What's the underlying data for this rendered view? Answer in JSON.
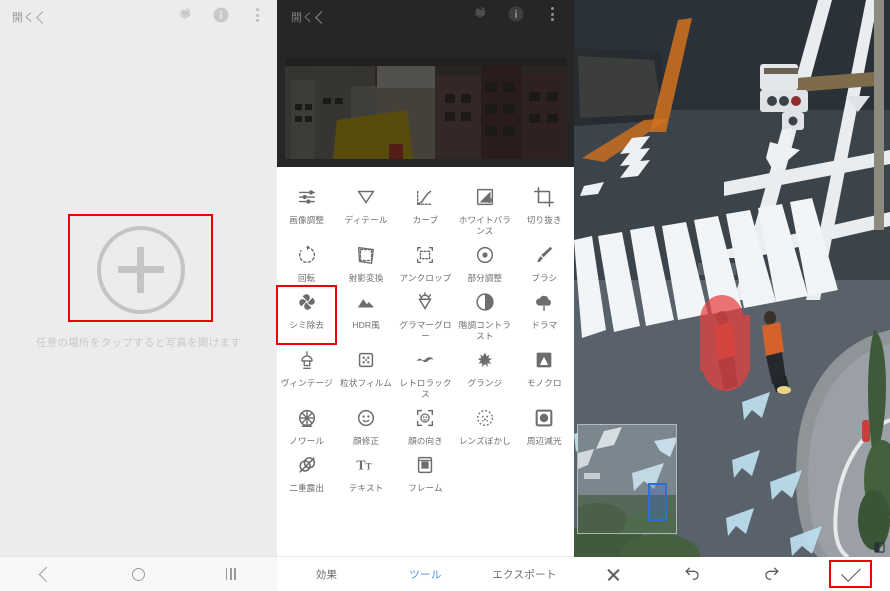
{
  "panel_left": {
    "topbar": {
      "open_label": "開く",
      "icons": [
        "rotate-layers-icon",
        "info-icon",
        "overflow-menu-icon"
      ]
    },
    "add_photo": {
      "icon": "plus-circle-icon",
      "highlight_color": "#f00000"
    },
    "hint_text": "任意の場所をタップすると写真を開けます",
    "navbar": {
      "back": "back-icon",
      "home": "home-icon",
      "recents": "recents-icon"
    }
  },
  "panel_middle": {
    "topbar": {
      "open_label": "開く",
      "icons": [
        "rotate-layers-icon",
        "info-icon",
        "overflow-menu-icon"
      ]
    },
    "preview": {
      "description": "cityscape photo of buildings with yellow sign"
    },
    "tools": [
      {
        "label": "画像調整",
        "icon": "tune-icon",
        "highlighted": false
      },
      {
        "label": "ディテール",
        "icon": "triangle-down-icon",
        "highlighted": false
      },
      {
        "label": "カーブ",
        "icon": "curves-icon",
        "highlighted": false
      },
      {
        "label": "ホワイトバランス",
        "icon": "white-balance-icon",
        "highlighted": false
      },
      {
        "label": "切り抜き",
        "icon": "crop-icon",
        "highlighted": false
      },
      {
        "label": "回転",
        "icon": "rotate-icon",
        "highlighted": false
      },
      {
        "label": "射影変換",
        "icon": "perspective-icon",
        "highlighted": false
      },
      {
        "label": "アンクロップ",
        "icon": "expand-crop-icon",
        "highlighted": false
      },
      {
        "label": "部分調整",
        "icon": "selective-icon",
        "highlighted": false
      },
      {
        "label": "ブラシ",
        "icon": "brush-icon",
        "highlighted": false
      },
      {
        "label": "シミ除去",
        "icon": "healing-icon",
        "highlighted": true
      },
      {
        "label": "HDR風",
        "icon": "hdr-mountain-icon",
        "highlighted": false
      },
      {
        "label": "グラマーグロー",
        "icon": "glamour-glow-icon",
        "highlighted": false
      },
      {
        "label": "階調コントラスト",
        "icon": "tonal-contrast-icon",
        "highlighted": false
      },
      {
        "label": "ドラマ",
        "icon": "drama-cloud-icon",
        "highlighted": false
      },
      {
        "label": "ヴィンテージ",
        "icon": "vintage-lamp-icon",
        "highlighted": false
      },
      {
        "label": "粒状フィルム",
        "icon": "grainy-film-icon",
        "highlighted": false
      },
      {
        "label": "レトロラックス",
        "icon": "retrolux-icon",
        "highlighted": false
      },
      {
        "label": "グランジ",
        "icon": "grunge-icon",
        "highlighted": false
      },
      {
        "label": "モノクロ",
        "icon": "monochrome-icon",
        "highlighted": false
      },
      {
        "label": "ノワール",
        "icon": "noir-reel-icon",
        "highlighted": false
      },
      {
        "label": "顔修正",
        "icon": "face-retouch-icon",
        "highlighted": false
      },
      {
        "label": "顔の向き",
        "icon": "head-pose-icon",
        "highlighted": false
      },
      {
        "label": "レンズぼかし",
        "icon": "lens-blur-icon",
        "highlighted": false
      },
      {
        "label": "周辺減光",
        "icon": "vignette-icon",
        "highlighted": false
      },
      {
        "label": "二重露出",
        "icon": "double-exposure-icon",
        "highlighted": false
      },
      {
        "label": "テキスト",
        "icon": "text-icon",
        "highlighted": false
      },
      {
        "label": "フレーム",
        "icon": "frame-icon",
        "highlighted": false
      }
    ],
    "tabs": [
      {
        "label": "効果",
        "active": false
      },
      {
        "label": "ツール",
        "active": true
      },
      {
        "label": "エクスポート",
        "active": false
      }
    ],
    "accent_color": "#4a90d9"
  },
  "panel_right": {
    "image": {
      "description": "aerial view of a street crossing with crosswalk, traffic signal, blue road arrows and a pedestrian"
    },
    "mask": {
      "color": "#e8413f",
      "description": "red healing brush mask over pedestrian"
    },
    "magnifier": {
      "selection_color": "#2f6fd0"
    },
    "bottom_bar": [
      {
        "name": "cancel",
        "icon": "close-icon",
        "highlighted": false
      },
      {
        "name": "undo",
        "icon": "undo-icon",
        "highlighted": false
      },
      {
        "name": "redo",
        "icon": "redo-icon",
        "highlighted": false
      },
      {
        "name": "apply",
        "icon": "checkmark-icon",
        "highlighted": true
      }
    ],
    "highlight_color": "#f00000"
  }
}
